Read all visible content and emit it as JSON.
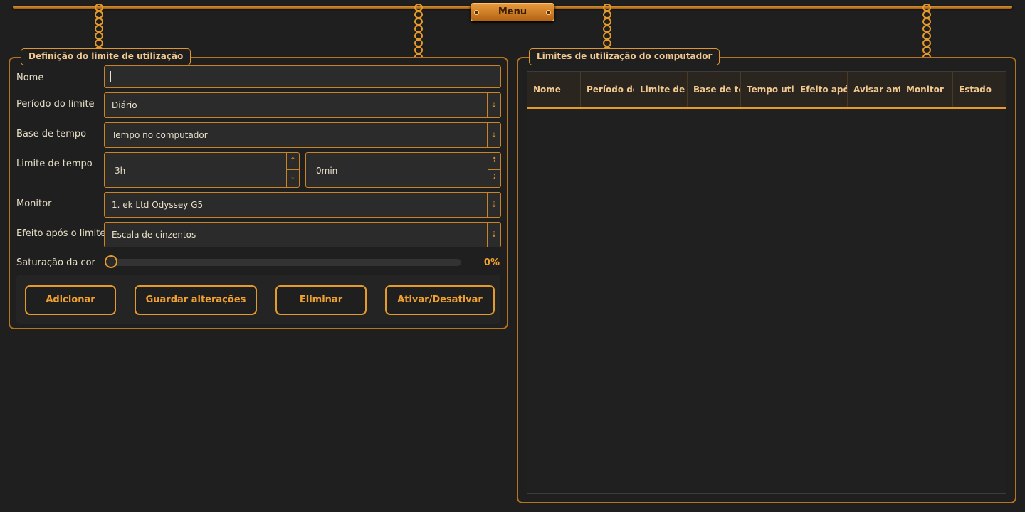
{
  "menu": {
    "label": "Menu"
  },
  "form_panel": {
    "title": "Definição do limite de utilização",
    "fields": {
      "name": {
        "label": "Nome",
        "value": ""
      },
      "period": {
        "label": "Período do limite",
        "value": "Diário"
      },
      "time_base": {
        "label": "Base de tempo",
        "value": "Tempo no computador"
      },
      "time_limit": {
        "label": "Limite de tempo",
        "hours": "3h",
        "minutes": "0min"
      },
      "monitor": {
        "label": "Monitor",
        "value": "1. ek Ltd Odyssey G5"
      },
      "effect": {
        "label": "Efeito após o limite",
        "value": "Escala de cinzentos"
      },
      "saturation": {
        "label": "Saturação da cor",
        "value": 0,
        "value_label": "0%"
      }
    },
    "buttons": {
      "add": "Adicionar",
      "save": "Guardar alterações",
      "delete": "Eliminar",
      "toggle": "Ativar/Desativar"
    }
  },
  "table_panel": {
    "title": "Limites de utilização do computador",
    "columns": [
      "Nome",
      "Período do",
      "Limite de t",
      "Base de te",
      "Tempo util",
      "Efeito após",
      "Avisar ante",
      "Monitor",
      "Estado"
    ],
    "rows": []
  },
  "colors": {
    "accent": "#e59a2a",
    "background": "#1f1f1f",
    "field": "#2b2b2b"
  }
}
